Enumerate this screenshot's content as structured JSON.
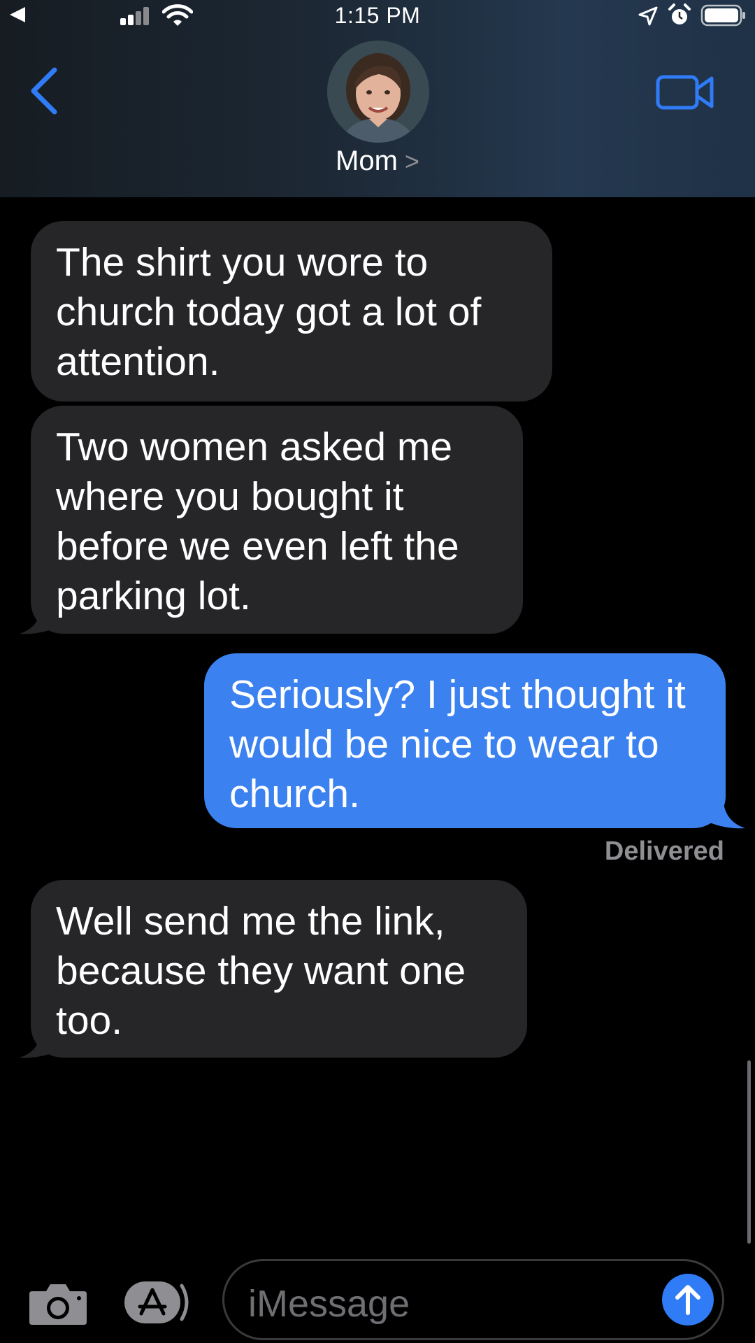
{
  "status_bar": {
    "time": "1:15 PM",
    "back_icon": "back-triangle-icon",
    "signal_icon": "cellular-signal-icon",
    "wifi_icon": "wifi-icon",
    "location_icon": "location-arrow-icon",
    "alarm_icon": "alarm-clock-icon",
    "battery_icon": "battery-icon"
  },
  "header": {
    "contact_name": "Mom",
    "name_chevron": ">",
    "back_icon": "chevron-left-icon",
    "video_icon": "video-camera-icon",
    "avatar": "contact-photo"
  },
  "messages": [
    {
      "direction": "received",
      "text": "The shirt you wore to\nchurch today got a lot of\nattention."
    },
    {
      "direction": "received",
      "text": "Two women asked me\nwhere you bought it\nbefore we even left the\nparking lot."
    },
    {
      "direction": "sent",
      "text": "Seriously? I just thought it\nwould be nice to wear to\nchurch."
    },
    {
      "direction": "received",
      "text": "Well send me the link,\nbecause they want one\ntoo."
    }
  ],
  "delivery_status": "Delivered",
  "input_bar": {
    "camera_icon": "camera-icon",
    "appstore_icon": "app-store-icon",
    "placeholder": "iMessage",
    "send_icon": "arrow-up-icon"
  },
  "colors": {
    "sent_bubble": "#3b82f0",
    "received_bubble": "#262629",
    "accent": "#2f7cf6",
    "background": "#000000"
  }
}
